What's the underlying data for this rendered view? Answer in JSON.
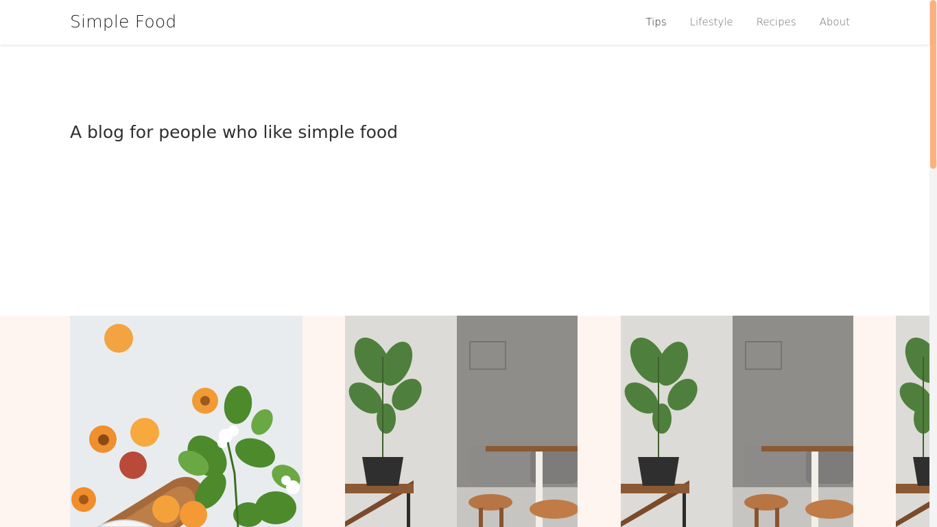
{
  "header": {
    "brand": "Simple Food",
    "nav": [
      {
        "label": "Tips",
        "active": true
      },
      {
        "label": "Lifestyle",
        "active": false
      },
      {
        "label": "Recipes",
        "active": false
      },
      {
        "label": "About",
        "active": false
      }
    ]
  },
  "hero": {
    "title": "A blog for people who like simple food"
  },
  "gallery": {
    "images": [
      {
        "icon": "apricots-photo"
      },
      {
        "icon": "plant-cafe-photo"
      },
      {
        "icon": "plant-cafe-photo"
      },
      {
        "icon": "plant-cafe-photo"
      }
    ]
  },
  "colors": {
    "accent": "#ffb07f",
    "band": "#fff5f0"
  }
}
